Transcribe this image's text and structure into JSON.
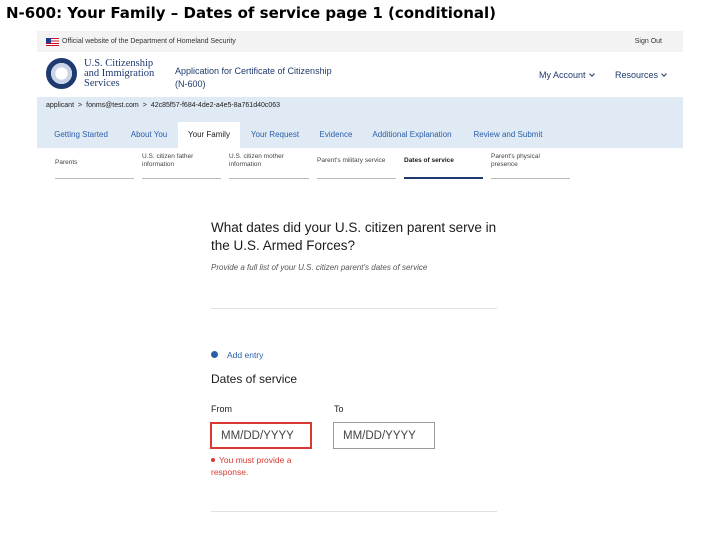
{
  "slide_title": "N-600: Your Family – Dates of service page 1 (conditional)",
  "banner": {
    "official": "Official website of the Department of Homeland Security",
    "sign_out": "Sign Out"
  },
  "header": {
    "agency_line1": "U.S. Citizenship",
    "agency_line2": "and Immigration",
    "agency_line3": "Services",
    "app_title_line1": "Application for Certificate of Citizenship",
    "app_title_line2": "(N-600)",
    "my_account": "My Account",
    "resources": "Resources"
  },
  "breadcrumb": {
    "items": [
      "applicant",
      "fonms@test.com",
      "42c85f57-f684-4de2-a4e5-8a761d40c063"
    ]
  },
  "tabs": [
    {
      "label": "Getting Started",
      "active": false
    },
    {
      "label": "About You",
      "active": false
    },
    {
      "label": "Your Family",
      "active": true
    },
    {
      "label": "Your Request",
      "active": false
    },
    {
      "label": "Evidence",
      "active": false
    },
    {
      "label": "Additional Explanation",
      "active": false
    },
    {
      "label": "Review and Submit",
      "active": false
    }
  ],
  "subnav": [
    {
      "line1": "Parents",
      "line2": "",
      "active": false
    },
    {
      "line1": "U.S. citizen father",
      "line2": "information",
      "active": false
    },
    {
      "line1": "U.S. citizen mother",
      "line2": "information",
      "active": false
    },
    {
      "line1": "Parent's military service",
      "line2": "",
      "active": false
    },
    {
      "line1": "Dates of service",
      "line2": "",
      "active": true
    },
    {
      "line1": "Parent's physical",
      "line2": "presence",
      "active": false
    }
  ],
  "main": {
    "question": "What dates did your U.S. citizen parent serve in the U.S. Armed Forces?",
    "hint": "Provide a full list of your U.S. citizen parent's dates of service",
    "add_entry": "Add entry",
    "section_label": "Dates of service",
    "from_label": "From",
    "to_label": "To",
    "from_placeholder": "MM/DD/YYYY",
    "to_placeholder": "MM/DD/YYYY",
    "error": "You must provide a response."
  },
  "colors": {
    "primary": "#1f3a6e",
    "link": "#2a5fa8",
    "error": "#d83933",
    "crumb_bg": "#dfeaf5"
  }
}
